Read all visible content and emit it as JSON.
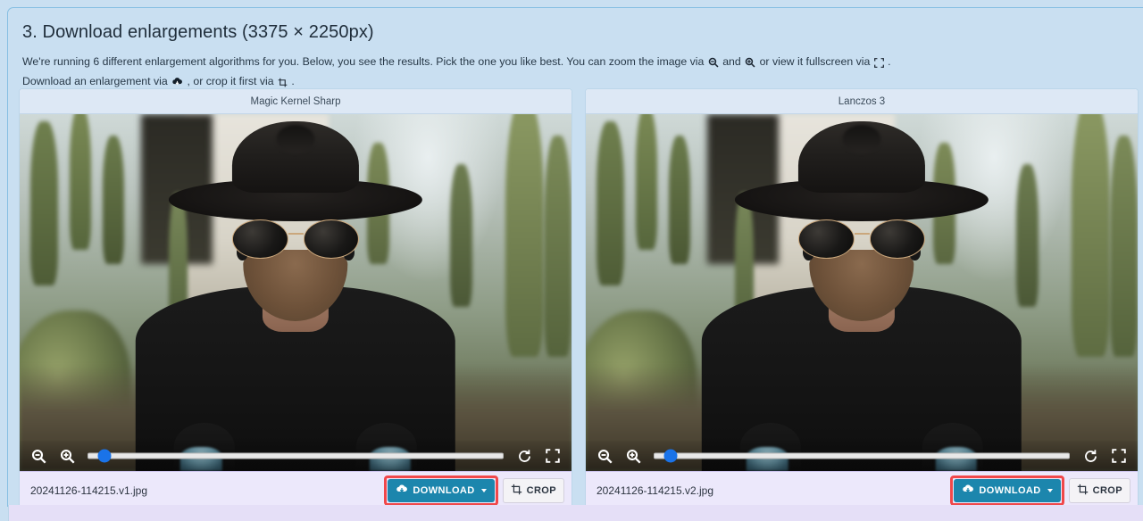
{
  "step": {
    "title": "3. Download enlargements (3375 × 2250px)",
    "desc_part1": "We're running 6 different enlargement algorithms for you. Below, you see the results. Pick the one you like best. You can zoom the image via",
    "desc_and": "and",
    "desc_part2": "or view it fullscreen via",
    "desc_period": ".",
    "desc_line2_part1": "Download an enlargement via",
    "desc_line2_part2": ", or crop it first via",
    "desc_line2_period": "."
  },
  "colors": {
    "page_background": "#c9dff1",
    "panel_header": "#dde8f5",
    "panel_footer": "#ece8fb",
    "download_button": "#1c86ad",
    "highlight_border": "#f0484a",
    "slider_thumb": "#1a73e8"
  },
  "panels": [
    {
      "algorithm": "Magic Kernel Sharp",
      "filename": "20241126-114215.v1.jpg",
      "download_label": "DOWNLOAD",
      "crop_label": "CROP",
      "zoom_level_percent": 4,
      "highlighted": true
    },
    {
      "algorithm": "Lanczos 3",
      "filename": "20241126-114215.v2.jpg",
      "download_label": "DOWNLOAD",
      "crop_label": "CROP",
      "zoom_level_percent": 4,
      "highlighted": true
    }
  ],
  "toolbar_icons": {
    "zoom_out": "zoom-out-icon",
    "zoom_in": "zoom-in-icon",
    "reset": "reset-icon",
    "fullscreen": "fullscreen-icon"
  }
}
